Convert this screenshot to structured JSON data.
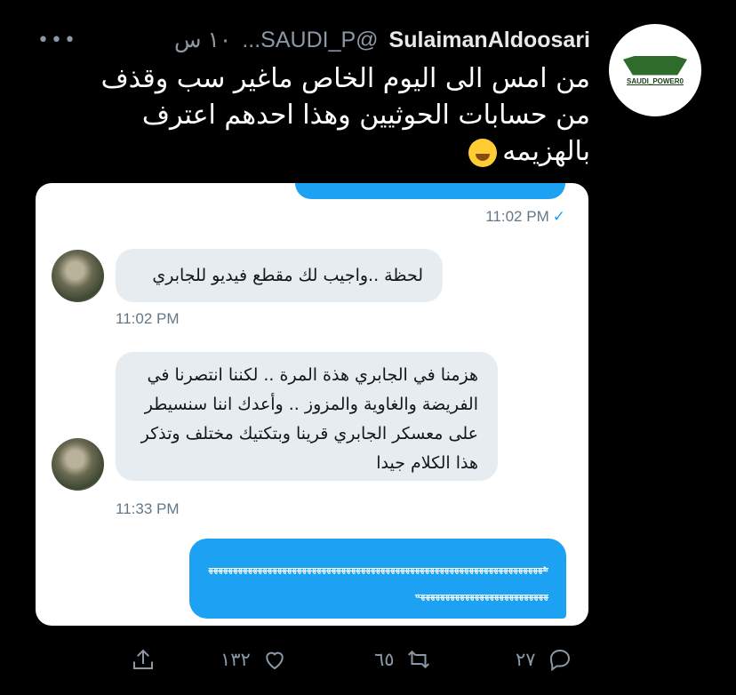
{
  "tweet": {
    "name": "SulaimanAldoosari",
    "handle": "@SAUDI_P...",
    "time": "١٠ س",
    "more_icon": "more-dots-icon",
    "text": "من امس الى اليوم الخاص ماغير سب وقذف من حسابات الحوثيين وهذا احدهم اعترف بالهزيمه",
    "emoji": "rolling-on-floor-laughing-emoji",
    "avatar_logo_text": "SAUDI_POWER0"
  },
  "chat": {
    "sent_time_top": "11:02 PM",
    "messages_in": [
      {
        "text": "لحظة ..واجيب لك مقطع فيديو للجابري",
        "time": "11:02 PM"
      },
      {
        "text": "هزمنا في الجابري هذة المرة .. لكننا انتصرنا في الفريضة والغاوية والمزوز .. وأعدك اننا سنسيطر على معسكر الجابري قرينا وبتكتيك مختلف وتذكر هذا الكلام جيدا",
        "time": "11:33 PM"
      }
    ],
    "message_out": "هههههههههههههههههههههههههههههههههههههههههههههههههههههههههههههههههههههههههههههههههههههههههههههههه"
  },
  "actions": {
    "reply_count": "٢٧",
    "retweet_count": "٦٥",
    "like_count": "١٣٢"
  },
  "colors": {
    "background": "#000000",
    "accent": "#1da1f2",
    "muted": "#8b98a5",
    "bubble_in": "#e6ecf0"
  }
}
